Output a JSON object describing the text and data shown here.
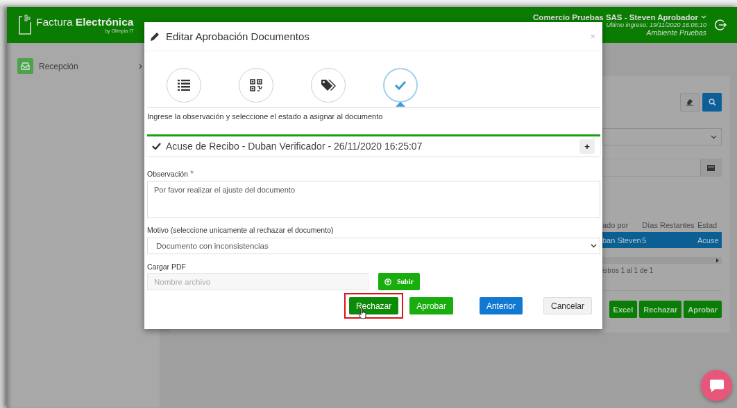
{
  "header": {
    "logo_title": "Factura **Electrónica**",
    "logo_subtitle": "by Olimpia IT",
    "user": "Comercio Pruebas SAS - Steven Aprobador",
    "last_login": "Último ingreso: 19/11/2020 16:06:10",
    "environment": "Ambiente Pruebas"
  },
  "sidebar": {
    "items": [
      {
        "label": "Recepción"
      }
    ]
  },
  "background": {
    "table": {
      "columns": [
        "ado por",
        "Días Restantes",
        "Estad"
      ],
      "rows": [
        {
          "cells": [
            "ban Steven",
            "5",
            "Acuse"
          ],
          "selected": true
        }
      ]
    },
    "pagination": "istros 1 al 1 de 1",
    "buttons": [
      "Excel",
      "Rechazar",
      "Aprobar"
    ]
  },
  "modal": {
    "title": "Editar Aprobación Documentos",
    "close": "×",
    "steps": [
      {
        "kind": "list",
        "selected": false
      },
      {
        "kind": "qr",
        "selected": false
      },
      {
        "kind": "tag",
        "selected": false
      },
      {
        "kind": "check",
        "selected": true
      }
    ],
    "instruction": "Ingrese la observación y seleccione el estado a asignar al documento",
    "history": {
      "text": "Acuse de Recibo - Duban Verificador - 26/11/2020 16:25:07",
      "toggle": "+"
    },
    "observation": {
      "label": "Observación",
      "required_mark": "*",
      "value": "Por favor realizar el ajuste del documento"
    },
    "reason": {
      "label": "Motivo (seleccione unicamente al rechazar el documento)",
      "value": "Documento con inconsistencias"
    },
    "upload": {
      "label": "Cargar PDF",
      "placeholder": "Nombre archivo",
      "button": "Subir"
    },
    "actions": [
      {
        "kind": "reject",
        "label": "Rechazar",
        "highlighted": true
      },
      {
        "kind": "approve",
        "label": "Aprobar",
        "highlighted": false
      },
      {
        "kind": "back",
        "label": "Anterior",
        "highlighted": false
      },
      {
        "kind": "cancel",
        "label": "Cancelar",
        "highlighted": false
      }
    ]
  }
}
